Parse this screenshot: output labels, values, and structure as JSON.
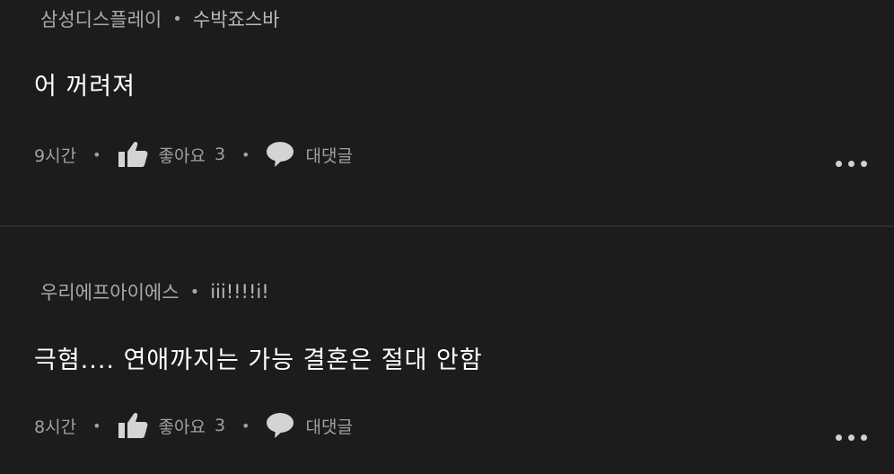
{
  "comments": [
    {
      "author": "삼성디스플레이",
      "nickname": "수박죠스바",
      "text": "어 꺼려져",
      "time": "9시간",
      "like_label": "좋아요",
      "like_count": "3",
      "reply_label": "대댓글"
    },
    {
      "author": "우리에프아이에스",
      "nickname": "iii!!!!i!",
      "text": "극혐.... 연애까지는 가능 결혼은 절대 안함",
      "time": "8시간",
      "like_label": "좋아요",
      "like_count": "3",
      "reply_label": "대댓글"
    }
  ],
  "separator": "•",
  "icons": {
    "like": "thumbs-up-icon",
    "reply": "speech-bubble-icon",
    "more": "more-dots-icon"
  },
  "colors": {
    "background": "#1c1c1c",
    "text": "#ffffff",
    "meta": "#a9a9a9"
  }
}
